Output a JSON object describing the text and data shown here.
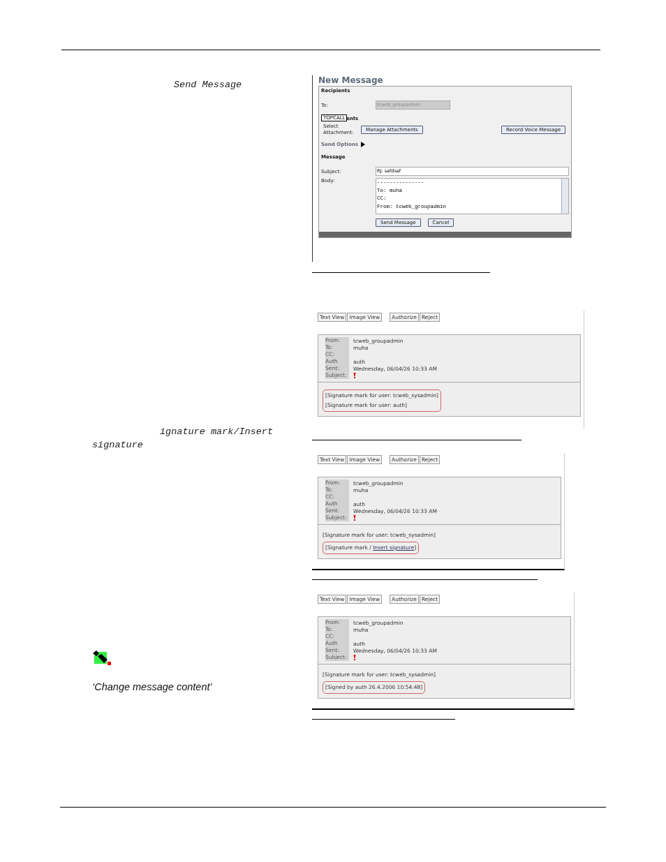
{
  "side_notes": [
    {
      "kind": "code",
      "text": "Send Message"
    },
    {
      "kind": "code",
      "text": "ignature mark/Insert signature"
    },
    {
      "kind": "icon"
    },
    {
      "kind": "quote",
      "text": "‘Change message content’"
    }
  ],
  "new_message": {
    "title": "New Message",
    "recipients_heading": "Recipients",
    "to_label": "To:",
    "to_value": "tcweb_groupadmin",
    "attachments_heading": "ents",
    "tooltip": "TOPCALL",
    "select_label": "Select Attachment:",
    "manage_button": "Manage Attachments",
    "record_button": "Record Voice Message",
    "send_options": {
      "label": "Send Options",
      "expanded": false
    },
    "message_heading": "Message",
    "subject_label": "Subject:",
    "subject_value": "RJ: safdsaf",
    "body_label": "Body:",
    "body_lines": [
      "---------------",
      "To: muha",
      "CC:",
      "From: tcweb_groupadmin"
    ],
    "buttons": [
      "Send Message",
      "Cancel"
    ]
  },
  "message_views": [
    {
      "toolbar": [
        [
          "Text View",
          "Image View"
        ],
        [
          "Authorize",
          "Reject"
        ]
      ],
      "fields": [
        {
          "label": "From:",
          "value": "tcweb_groupadmin",
          "kind": "text"
        },
        {
          "label": "To:",
          "value": "muha",
          "kind": "text"
        },
        {
          "label": "CC:",
          "kind": "text"
        },
        {
          "label": "Auth",
          "value": "auth",
          "kind": "text"
        },
        {
          "label": "Sent:",
          "value": "Wednesday, 06/04/26 10:33 AM",
          "kind": "text"
        },
        {
          "label": "Subject:",
          "kind": "priority"
        }
      ],
      "circled_lines": [
        {
          "text": "[Signature mark for user: tcweb_sysadmin]"
        },
        {
          "text": "[Signature mark for user: auth]"
        }
      ]
    },
    {
      "toolbar": [
        [
          "Text View",
          "Image View"
        ],
        [
          "Authorize",
          "Reject"
        ]
      ],
      "fields": [
        {
          "label": "From:",
          "value": "tcweb_groupadmin",
          "kind": "text"
        },
        {
          "label": "To:",
          "value": "muha",
          "kind": "text"
        },
        {
          "label": "CC:",
          "kind": "text"
        },
        {
          "label": "Auth",
          "value": "auth",
          "kind": "text"
        },
        {
          "label": "Sent:",
          "value": "Wednesday, 06/04/26 10:33 AM",
          "kind": "text"
        },
        {
          "label": "Subject:",
          "kind": "priority"
        }
      ],
      "plain_lines": [
        {
          "text": "[Signature mark for user: tcweb_sysadmin]"
        }
      ],
      "circled_lines": [
        {
          "text": "[Signature mark / ",
          "link": "Insert signature",
          "suffix": "]"
        }
      ]
    },
    {
      "toolbar": [
        [
          "Text View",
          "Image View"
        ],
        [
          "Authorize",
          "Reject"
        ]
      ],
      "fields": [
        {
          "label": "From:",
          "value": "tcweb_groupadmin",
          "kind": "text"
        },
        {
          "label": "To:",
          "value": "muha",
          "kind": "text"
        },
        {
          "label": "CC:",
          "kind": "text"
        },
        {
          "label": "Auth",
          "value": "auth",
          "kind": "text"
        },
        {
          "label": "Sent:",
          "value": "Wednesday, 06/04/26 10:33 AM",
          "kind": "text"
        },
        {
          "label": "Subject:",
          "kind": "priority"
        }
      ],
      "plain_lines": [
        {
          "text": "[Signature mark for user: tcweb_sysadmin]"
        }
      ],
      "circled_lines": [
        {
          "text": "[Signed by auth 26.4.2006 10:54:48]"
        }
      ]
    }
  ]
}
